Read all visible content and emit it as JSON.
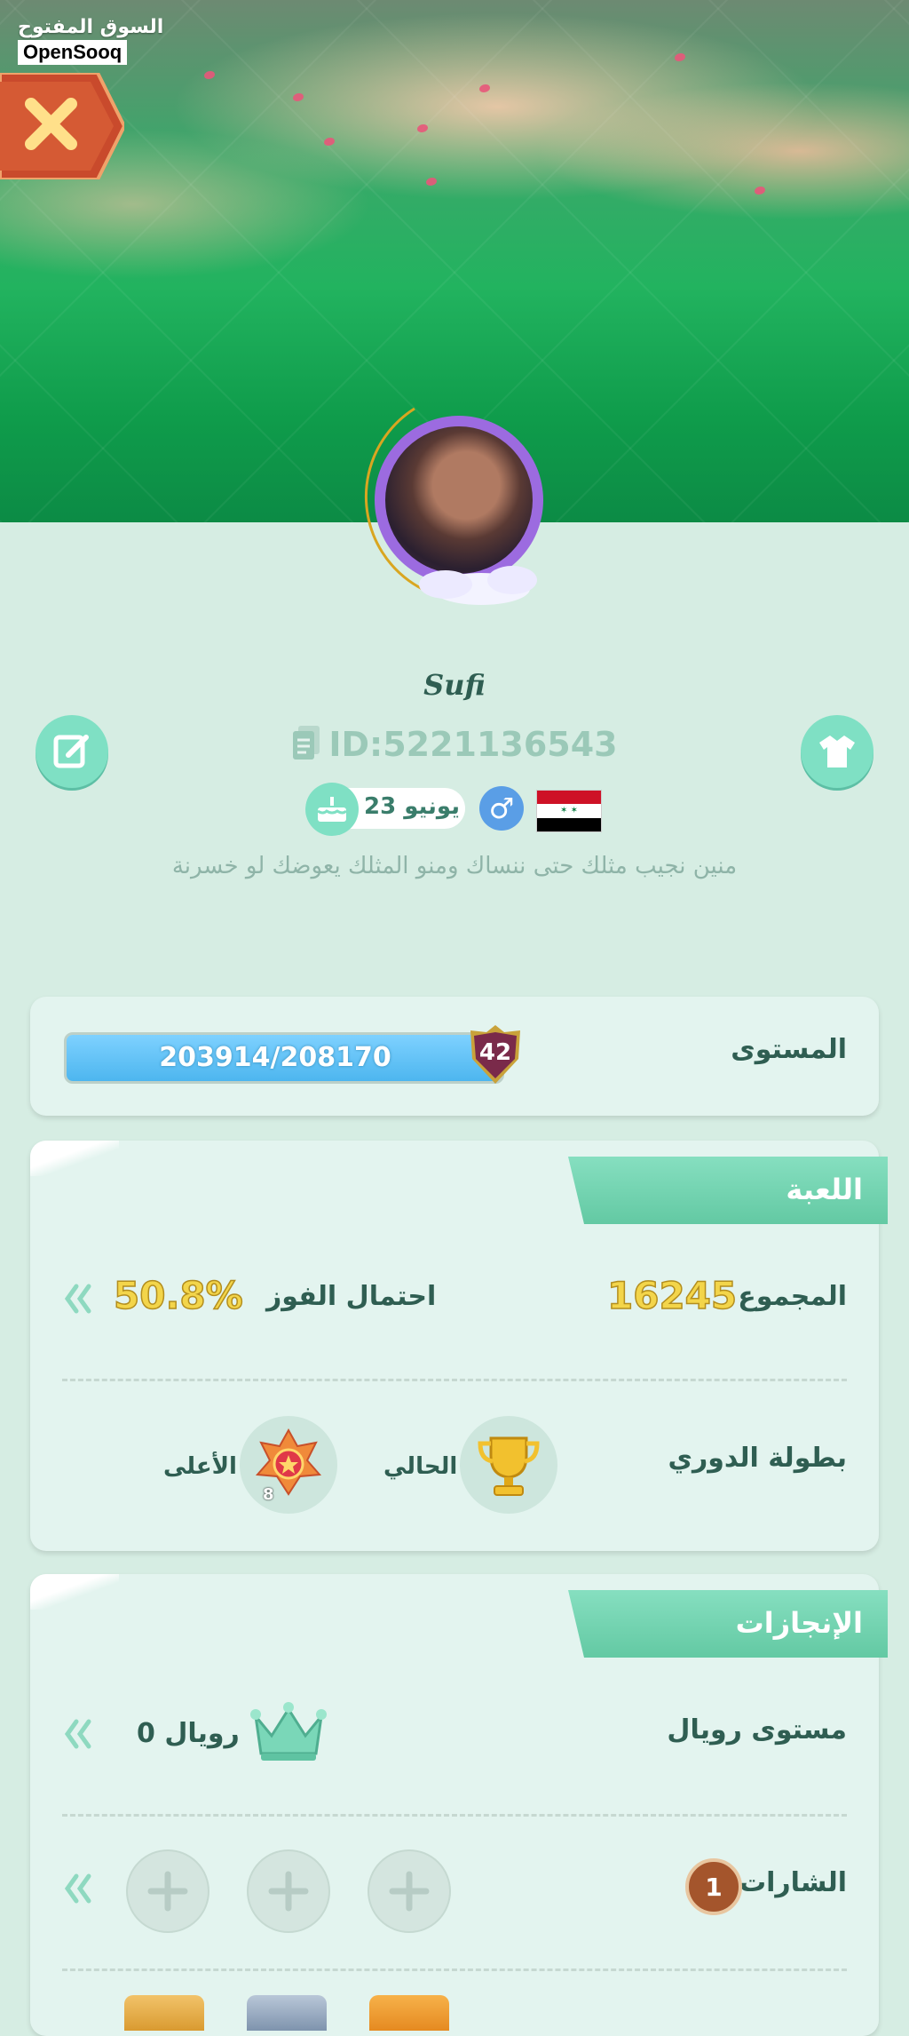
{
  "watermark": {
    "arabic": "السوق المفتوح",
    "english": "OpenSooq"
  },
  "profile": {
    "username": "Sufi",
    "id_text": "ID:5221136543",
    "birthday": "23 يونيو",
    "gender_symbol": "♂",
    "motto": "منين نجيب مثلك حتى ننساك ومنو المثلك يعوضك لو خسرنة"
  },
  "level": {
    "label": "المستوى",
    "progress_text": "203914/208170",
    "progress_fraction": 0.98,
    "level_number": "42"
  },
  "game": {
    "title": "اللعبة",
    "total_label": "المجموع",
    "total_value": "16245",
    "win_label": "احتمال الفوز",
    "win_value": "50.8%",
    "league_label": "بطولة الدوري",
    "current_label": "الحالي",
    "highest_label": "الأعلى",
    "highest_rank": "8"
  },
  "achievements": {
    "title": "الإنجازات",
    "royal_label": "مستوى رويال",
    "royal_value": "رويال 0",
    "badges_label": "الشارات",
    "badges_count": "1"
  }
}
